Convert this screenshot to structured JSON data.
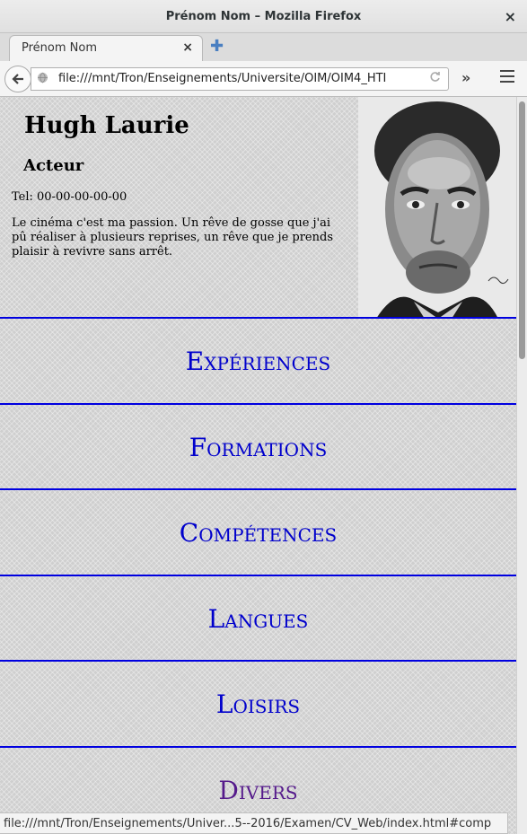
{
  "window": {
    "title": "Prénom Nom – Mozilla Firefox",
    "close_icon": "×"
  },
  "tabs": [
    {
      "label": "Prénom Nom",
      "close_icon": "×"
    }
  ],
  "new_tab_icon": "✚",
  "navbar": {
    "url": "file:///mnt/Tron/Enseignements/Universite/OIM/OIM4_HTI",
    "overflow_icon": "»"
  },
  "profile": {
    "name": "Hugh Laurie",
    "job": "Acteur",
    "tel": "Tel: 00-00-00-00-00",
    "bio": "Le cinéma c'est ma passion. Un rêve de gosse que j'ai pû réaliser à plusieurs reprises, un rêve que je prends plaisir à revivre sans arrêt."
  },
  "sections": [
    {
      "label": "Expériences",
      "color": "#0000cc"
    },
    {
      "label": "Formations",
      "color": "#0000cc"
    },
    {
      "label": "Compétences",
      "color": "#0000cc"
    },
    {
      "label": "Langues",
      "color": "#0000cc"
    },
    {
      "label": "Loisirs",
      "color": "#0000cc"
    },
    {
      "label": "Divers",
      "color": "#551a8b"
    }
  ],
  "status_url": "file:///mnt/Tron/Enseignements/Univer...5--2016/Examen/CV_Web/index.html#comp"
}
